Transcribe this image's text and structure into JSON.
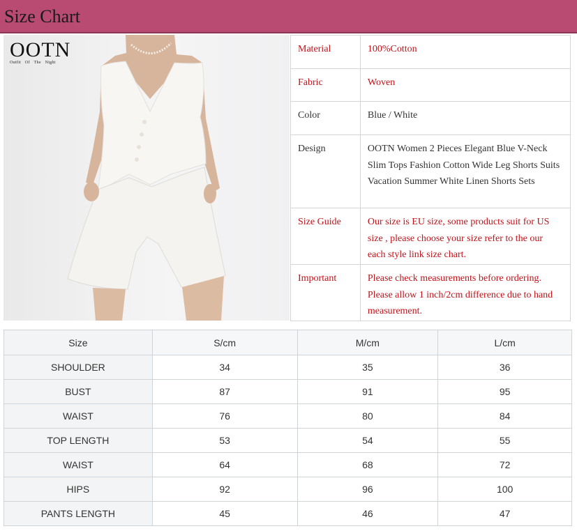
{
  "banner": {
    "title": "Size Chart"
  },
  "logo": {
    "word": "OOTN",
    "tagline": "Outfit Of The Night"
  },
  "colors": {
    "banner": "#b94a72",
    "red_text": "#c1121a",
    "header_bg": "#f5f7f8"
  },
  "info": [
    {
      "key": "Material",
      "value": "100%Cotton",
      "style": "red"
    },
    {
      "key": "Fabric",
      "value": "Woven",
      "style": "red"
    },
    {
      "key": "Color",
      "value": "Blue / White",
      "style": "dark"
    },
    {
      "key": "Design",
      "value": "OOTN Women 2 Pieces Elegant Blue V-Neck Slim Tops Fashion Cotton Wide Leg Shorts Suits Vacation Summer White Linen Shorts Sets",
      "style": "dark"
    },
    {
      "key": "Size Guide",
      "value": "Our size is EU size, some products suit for US size , please choose your size refer to the our each style link size chart.",
      "style": "red"
    },
    {
      "key": "Important",
      "value": "Please check measurements before ordering. Please allow 1 inch/2cm difference due to hand measurement.",
      "style": "red"
    }
  ],
  "sizes": {
    "headers": [
      "Size",
      "S/cm",
      "M/cm",
      "L/cm"
    ],
    "rows": [
      [
        "SHOULDER",
        "34",
        "35",
        "36"
      ],
      [
        "BUST",
        "87",
        "91",
        "95"
      ],
      [
        "WAIST",
        "76",
        "80",
        "84"
      ],
      [
        "TOP LENGTH",
        "53",
        "54",
        "55"
      ],
      [
        "WAIST",
        "64",
        "68",
        "72"
      ],
      [
        "HIPS",
        "92",
        "96",
        "100"
      ],
      [
        "PANTS LENGTH",
        "45",
        "46",
        "47"
      ]
    ]
  }
}
